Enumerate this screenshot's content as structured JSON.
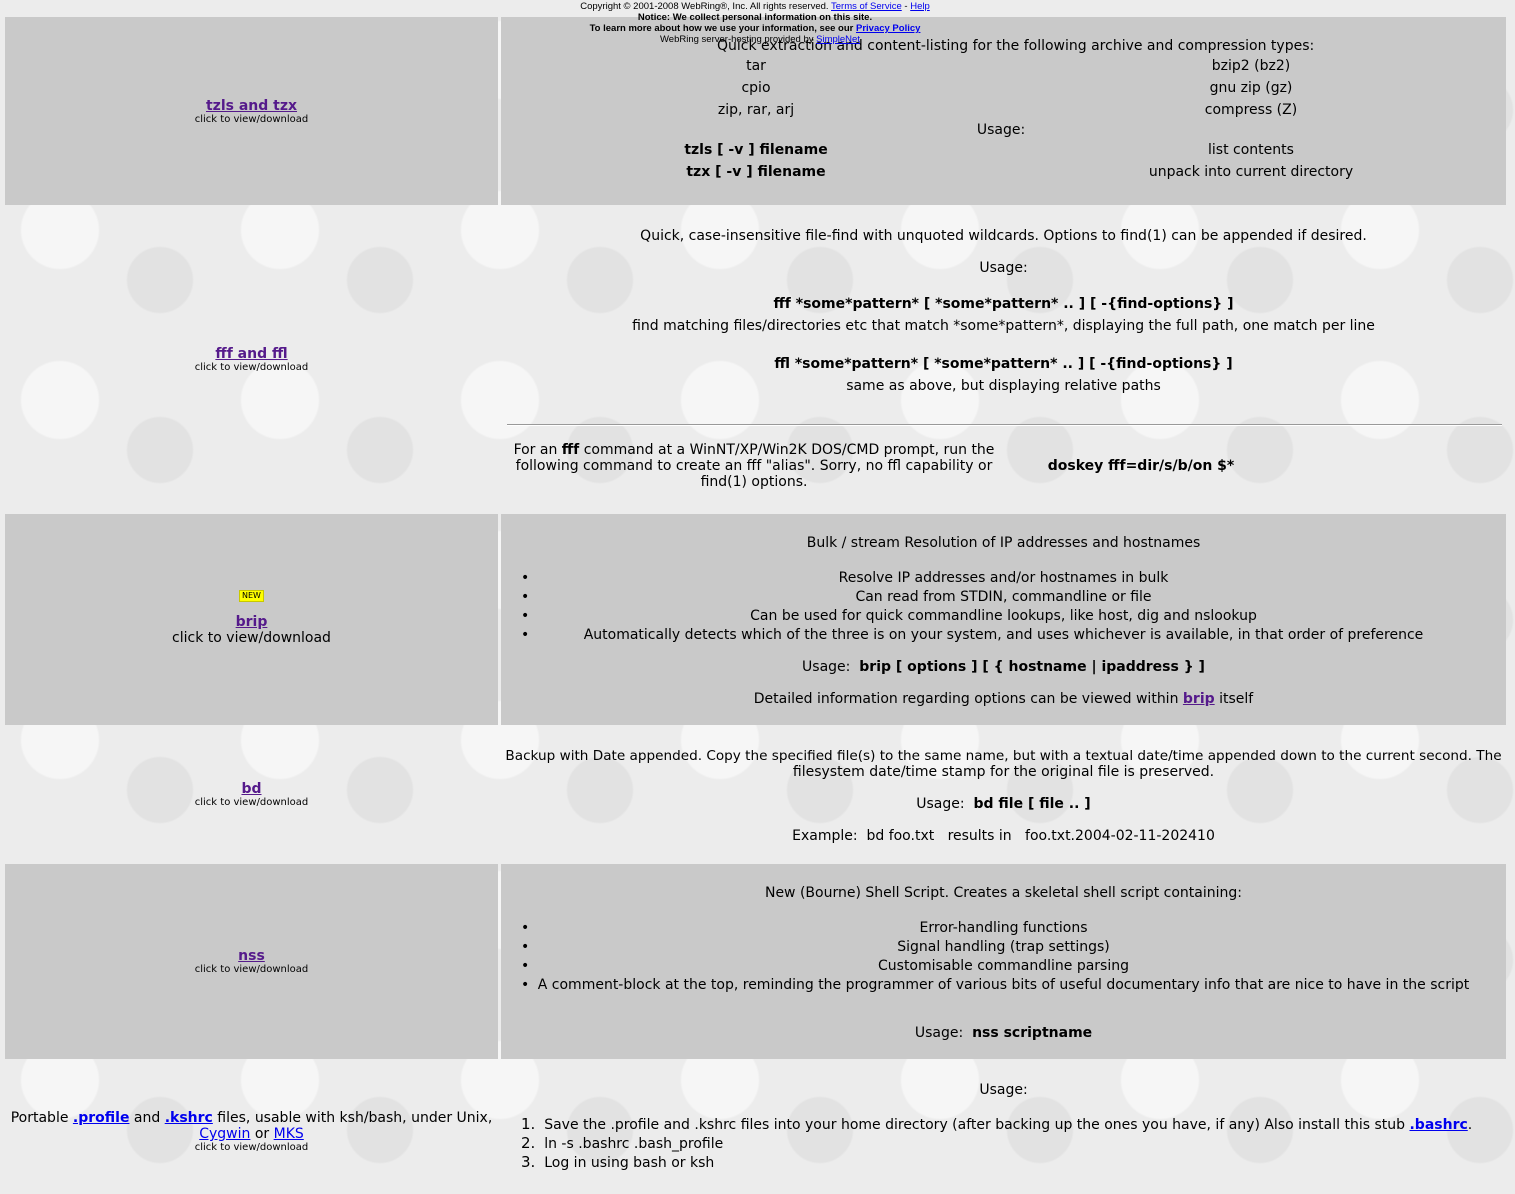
{
  "header": {
    "copyright": "Copyright © 2001-2008 WebRing®, Inc. All rights reserved.",
    "terms": "Terms of Service",
    "sep": "-",
    "help": "Help",
    "notice": "Notice: We collect personal information on this site.",
    "learn_prefix": "To learn more about how we use your information, see our",
    "privacy": "Privacy Policy",
    "hosting_prefix": "WebRing server-hosting provided by",
    "hosting_link": "SimpleNet"
  },
  "common": {
    "click_text": "click to view/download"
  },
  "tzls": {
    "name": "tzls and tzx",
    "intro": "Quick extraction and content-listing for the following archive and compression types:",
    "types_left": [
      "tar",
      "cpio",
      "zip, rar, arj"
    ],
    "types_right": [
      "bzip2 (bz2)",
      "gnu zip (gz)",
      "compress (Z)"
    ],
    "usage_label": "Usage:",
    "cmd1": "tzls [ -v ] filename",
    "desc1": "list contents",
    "cmd2": "tzx [ -v ] filename",
    "desc2": "unpack into current directory"
  },
  "fff": {
    "name": "fff and ffl",
    "intro": "Quick, case-insensitive file-find with unquoted wildcards.  Options to find(1) can be appended if desired.",
    "usage_label": "Usage:",
    "cmd1": "fff *some*pattern* [ *some*pattern* .. ] [ -{find-options} ]",
    "desc1": "find matching files/directories etc that match *some*pattern*, displaying the full path, one match per line",
    "cmd2": "ffl *some*pattern* [ *some*pattern* .. ] [ -{find-options} ]",
    "desc2": "same as above, but displaying relative paths",
    "dos_pre": "For an",
    "dos_bold": "fff",
    "dos_line1_rest": "command at a WinNT/XP/Win2K DOS/CMD prompt, run the",
    "dos_line2": "following command to create an fff \"alias\".  Sorry, no ffl capability or",
    "dos_line3": "find(1) options.",
    "doskey": "doskey fff=dir/s/b/on $*"
  },
  "brip": {
    "badge": "NEW",
    "name": "brip",
    "title": "Bulk / stream Resolution of IP addresses and hostnames",
    "bullets": [
      "Resolve IP addresses and/or hostnames in bulk",
      "Can read from STDIN, commandline or file",
      "Can be used for quick commandline lookups, like host, dig and nslookup",
      "Automatically detects which of the three is on your system, and uses whichever is available, in that order of preference"
    ],
    "usage_label": "Usage:",
    "usage_cmd": "brip [ options ] [ { hostname | ipaddress } ]",
    "detail_pre": "Detailed information regarding options can be viewed within",
    "detail_link": "brip",
    "detail_post": "itself"
  },
  "bd": {
    "name": "bd",
    "line1": "Backup with Date appended.  Copy the specified file(s) to the same name, but with a textual date/time appended down to the current second.  The",
    "line2": "filesystem date/time stamp for the original file is preserved.",
    "usage_label": "Usage:",
    "usage_cmd": "bd file [ file .. ]",
    "example": "Example:  bd foo.txt   results in   foo.txt.2004-02-11-202410"
  },
  "nss": {
    "name": "nss",
    "title": "New (Bourne) Shell Script.  Creates a skeletal shell script containing:",
    "bullets": [
      "Error-handling functions",
      "Signal handling (trap settings)",
      "Customisable commandline parsing",
      "A comment-block at the top, reminding the programmer of various bits of useful documentary info that are nice to have in the script"
    ],
    "usage_label": "Usage:",
    "usage_cmd": "nss scriptname"
  },
  "profile": {
    "pre": "Portable",
    "link1": ".profile",
    "and": "and",
    "link2": ".kshrc",
    "post": "files, usable with ksh/bash, under Unix,",
    "cygwin": "Cygwin",
    "or": "or",
    "mks": "MKS",
    "usage_label": "Usage:",
    "steps": [
      "Save the .profile and .kshrc files into your home directory (after backing up the ones you have, if any)  Also install this stub",
      "ln -s .bashrc .bash_profile",
      "Log in using bash or ksh"
    ],
    "bashrc_link": ".bashrc",
    "step1_end": "."
  }
}
